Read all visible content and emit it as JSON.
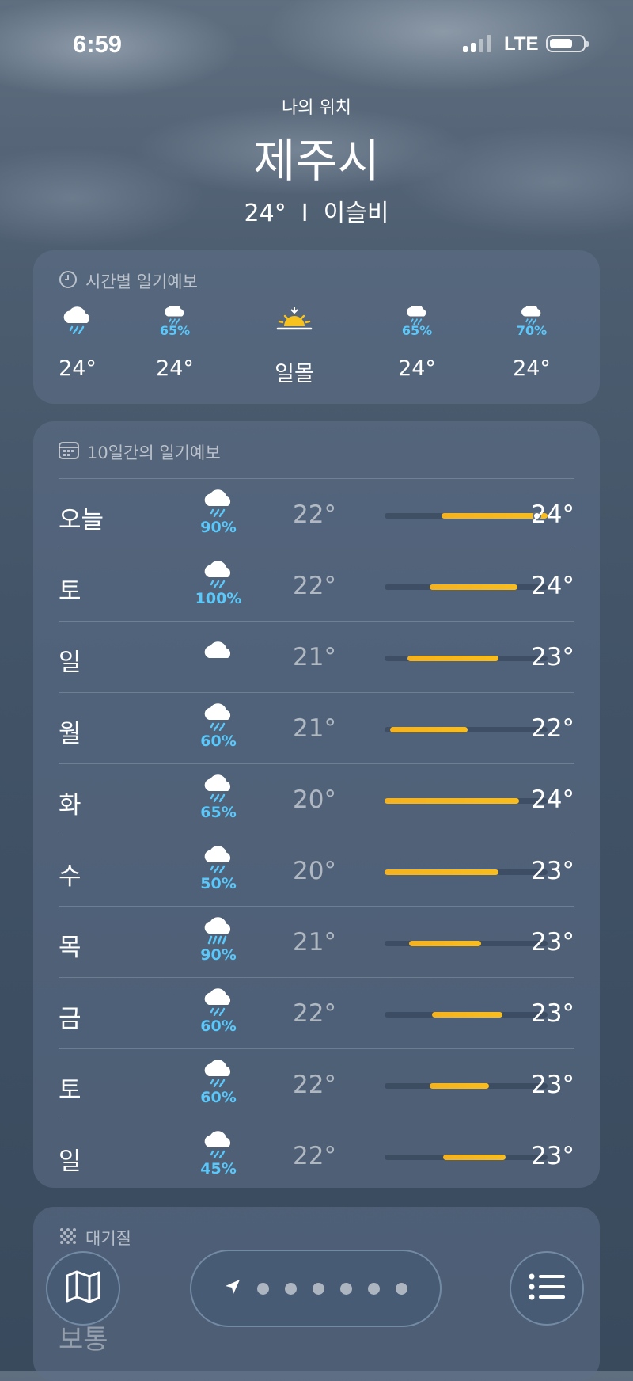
{
  "status": {
    "time": "6:59",
    "network": "LTE"
  },
  "header": {
    "my_location": "나의 위치",
    "city": "제주시",
    "current": "24°  I  이슬비"
  },
  "hourly": {
    "title": "시간별 일기예보",
    "items": [
      {
        "icon": "rain-cloud-icon",
        "pct": "",
        "temp": "24°"
      },
      {
        "icon": "rain-cloud-icon",
        "pct": "65%",
        "temp": "24°"
      },
      {
        "icon": "sunset-icon",
        "pct": "",
        "temp": "일몰"
      },
      {
        "icon": "rain-cloud-icon",
        "pct": "65%",
        "temp": "24°"
      },
      {
        "icon": "rain-cloud-icon",
        "pct": "70%",
        "temp": "24°"
      }
    ]
  },
  "daily": {
    "title": "10일간의 일기예보",
    "scale_min": 20,
    "scale_max": 24.3,
    "days": [
      {
        "day": "오늘",
        "icon": "rain-cloud-icon",
        "pct": "90%",
        "low": "22°",
        "high": "24°",
        "low_v": 21.5,
        "high_v": 24.3,
        "current": 24
      },
      {
        "day": "토",
        "icon": "rain-cloud-icon",
        "pct": "100%",
        "low": "22°",
        "high": "24°",
        "low_v": 21.2,
        "high_v": 23.5
      },
      {
        "day": "일",
        "icon": "cloud-icon",
        "pct": "",
        "low": "21°",
        "high": "23°",
        "low_v": 20.6,
        "high_v": 23.0
      },
      {
        "day": "월",
        "icon": "rain-cloud-icon",
        "pct": "60%",
        "low": "21°",
        "high": "22°",
        "low_v": 20.15,
        "high_v": 22.2
      },
      {
        "day": "화",
        "icon": "rain-cloud-icon",
        "pct": "65%",
        "low": "20°",
        "high": "24°",
        "low_v": 20.0,
        "high_v": 23.55
      },
      {
        "day": "수",
        "icon": "rain-cloud-icon",
        "pct": "50%",
        "low": "20°",
        "high": "23°",
        "low_v": 20.0,
        "high_v": 23.0
      },
      {
        "day": "목",
        "icon": "heavy-rain-cloud-icon",
        "pct": "90%",
        "low": "21°",
        "high": "23°",
        "low_v": 20.65,
        "high_v": 22.55
      },
      {
        "day": "금",
        "icon": "rain-cloud-icon",
        "pct": "60%",
        "low": "22°",
        "high": "23°",
        "low_v": 21.25,
        "high_v": 23.1
      },
      {
        "day": "토",
        "icon": "rain-cloud-icon",
        "pct": "60%",
        "low": "22°",
        "high": "23°",
        "low_v": 21.2,
        "high_v": 22.75
      },
      {
        "day": "일",
        "icon": "rain-cloud-icon",
        "pct": "45%",
        "low": "22°",
        "high": "23°",
        "low_v": 21.55,
        "high_v": 23.2
      }
    ]
  },
  "air_quality": {
    "title": "대기질",
    "value": "보통"
  },
  "nav": {
    "map": "map-icon",
    "location": "location-arrow-icon",
    "list": "list-icon",
    "pages": 6
  }
}
